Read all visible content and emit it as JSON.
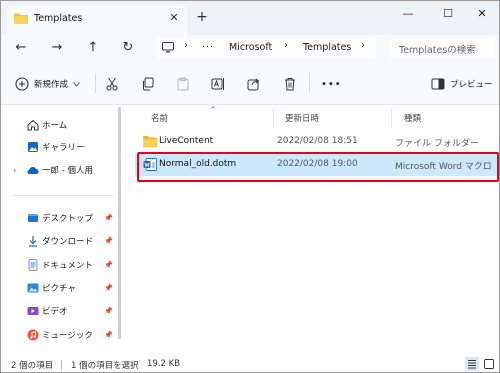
{
  "window": {
    "tab_title": "Templates",
    "tab_close": "✕",
    "new_tab": "+",
    "minimize": "—",
    "maximize": "☐",
    "close": "✕"
  },
  "nav": {
    "back": "←",
    "forward": "→",
    "up": "↑",
    "refresh": "↻",
    "more_path": "···"
  },
  "address": {
    "segments": [
      "Microsoft",
      "Templates"
    ],
    "chevron": "›"
  },
  "search": {
    "placeholder": "Templatesの検索"
  },
  "toolbar": {
    "new_label": "新規作成",
    "more": "•••",
    "preview_label": "プレビュー"
  },
  "sidebar": {
    "items": [
      {
        "label": "ホーム",
        "icon": "home-icon"
      },
      {
        "label": "ギャラリー",
        "icon": "gallery-icon"
      },
      {
        "label": "一郎 - 個人用",
        "icon": "onedrive-cloud-icon"
      },
      {
        "label": "デスクトップ",
        "icon": "desktop-icon",
        "pinned": true
      },
      {
        "label": "ダウンロード",
        "icon": "download-icon",
        "pinned": true
      },
      {
        "label": "ドキュメント",
        "icon": "document-icon",
        "pinned": true
      },
      {
        "label": "ピクチャ",
        "icon": "pictures-icon",
        "pinned": true
      },
      {
        "label": "ビデオ",
        "icon": "video-icon",
        "pinned": true
      },
      {
        "label": "ミュージック",
        "icon": "music-icon",
        "pinned": true
      }
    ],
    "pin_glyph": "📌",
    "expand_chevron": "›"
  },
  "columns": {
    "name": "名前",
    "date": "更新日時",
    "type": "種類",
    "sort_caret": "^"
  },
  "files": [
    {
      "name": "LiveContent",
      "date": "2022/02/08 18:51",
      "type": "ファイル フォルダー",
      "icon": "folder-icon",
      "selected": false
    },
    {
      "name": "Normal_old.dotm",
      "date": "2022/02/08 19:00",
      "type": "Microsoft Word マクロ",
      "icon": "word-macro-template-icon",
      "selected": true
    }
  ],
  "status": {
    "item_count": "2 個の項目",
    "selected": "1 個の項目を選択",
    "size": "19.2 KB"
  },
  "colors": {
    "accent": "#0067c0",
    "selection": "#cce8ff",
    "highlight_border": "#e8001c",
    "folder": "#f3c43a"
  }
}
